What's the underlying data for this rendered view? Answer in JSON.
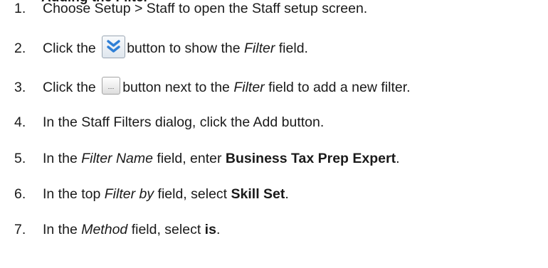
{
  "heading": "Adding the Filter",
  "steps": [
    {
      "num": "1.",
      "text": "Choose Setup > Staff to open the Staff setup screen."
    },
    {
      "num": "2.",
      "pre": "Click the",
      "post": "button to show the",
      "field": "Filter",
      "tail": "field."
    },
    {
      "num": "3.",
      "pre": "Click the",
      "post": "button next to the",
      "field": "Filter",
      "tail": "field to add a new filter."
    },
    {
      "num": "4.",
      "text": "In the Staff Filters dialog, click the Add button."
    },
    {
      "num": "5.",
      "pre": "In the",
      "field": "Filter Name",
      "mid": "field, enter",
      "value": "Business Tax Prep Expert",
      "end": "."
    },
    {
      "num": "6.",
      "pre": "In the top",
      "field": "Filter by",
      "mid": "field, select",
      "value": "Skill Set",
      "end": "."
    },
    {
      "num": "7.",
      "pre": "In the",
      "field": "Method",
      "mid": "field, select",
      "value": "is",
      "end": "."
    }
  ],
  "icons": {
    "expand_button": "double-chevron-down-icon",
    "ellipsis_button": "ellipsis-icon",
    "ellipsis_glyph": "...",
    "accent": "#2f7fd6"
  }
}
